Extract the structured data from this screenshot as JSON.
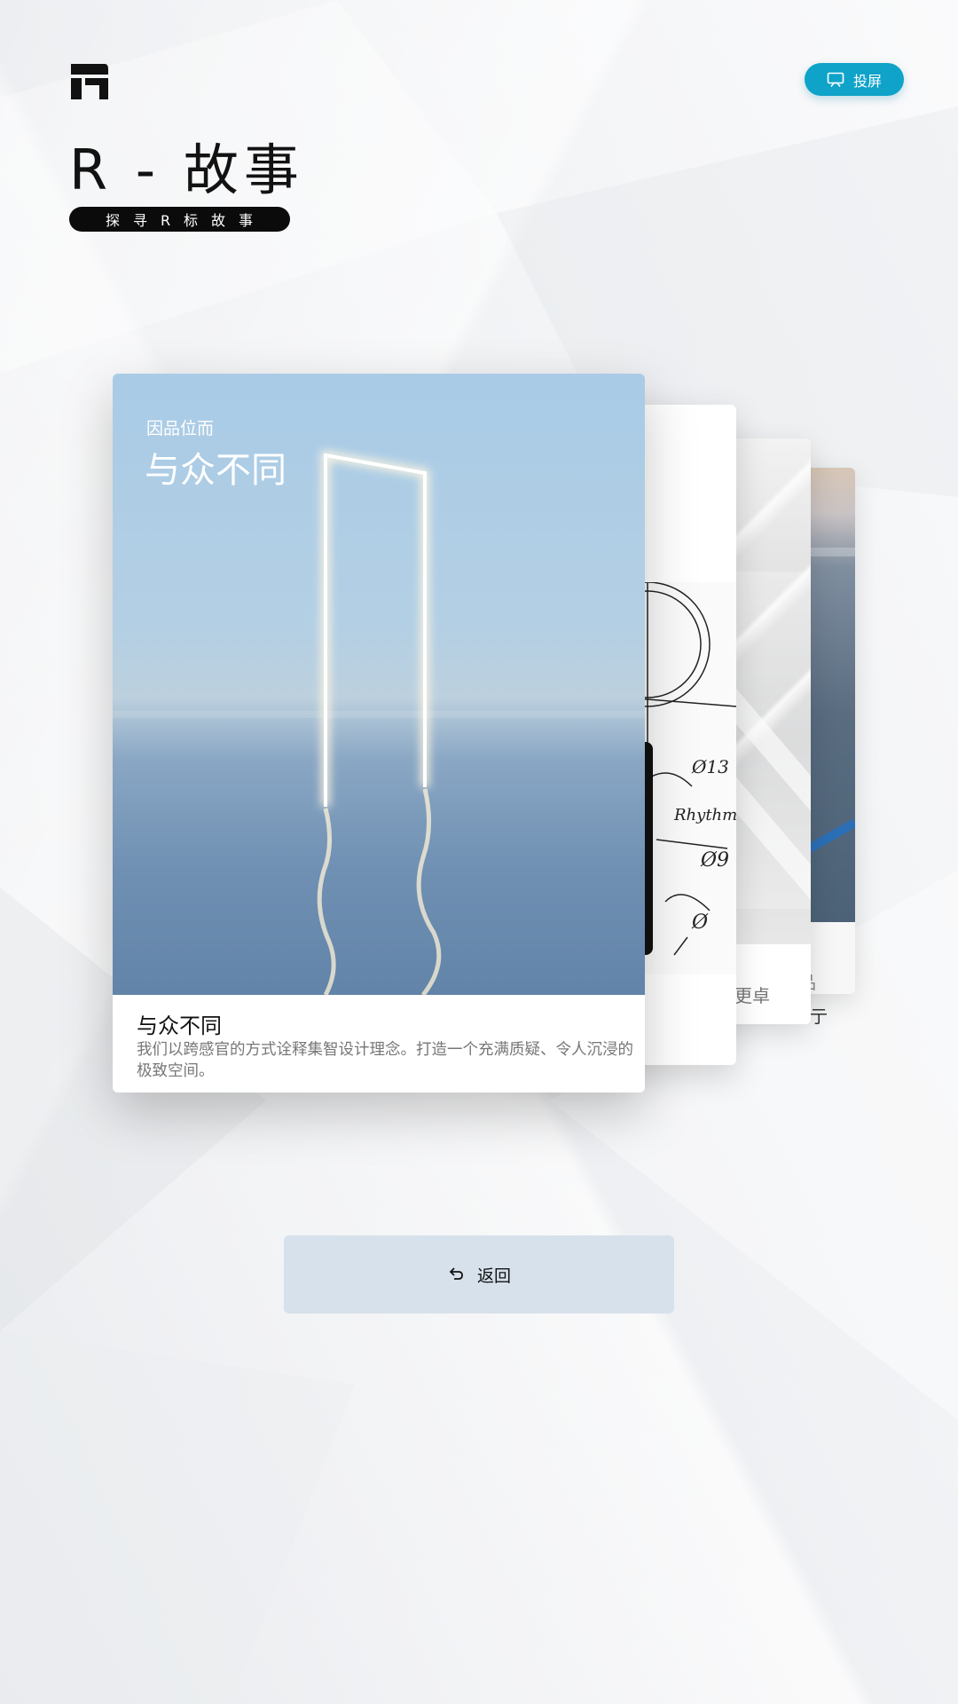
{
  "header": {
    "logo_icon": "r-brand-logo-icon",
    "cast_button": {
      "label": "投屏",
      "icon": "screen-cast-icon",
      "color": "#0fa3c9"
    },
    "title": "R - 故事",
    "subtitle": "探寻R标故事"
  },
  "cards": {
    "front": {
      "image_kicker": "因品位而",
      "image_title": "与众不同",
      "caption_title": "与众不同",
      "caption_description": "我们以跨感官的方式诠释集智设计理念。打造一个充满质疑、令人沉浸的极致空间。"
    },
    "second": {},
    "third": {
      "caption_fragment": "更卓"
    },
    "fourth": {
      "caption_fragment": "品",
      "caption_fragment_2": "亍"
    }
  },
  "footer": {
    "back_button": {
      "label": "返回",
      "icon": "return-arrow-icon",
      "color": "#d7e1ec"
    }
  }
}
